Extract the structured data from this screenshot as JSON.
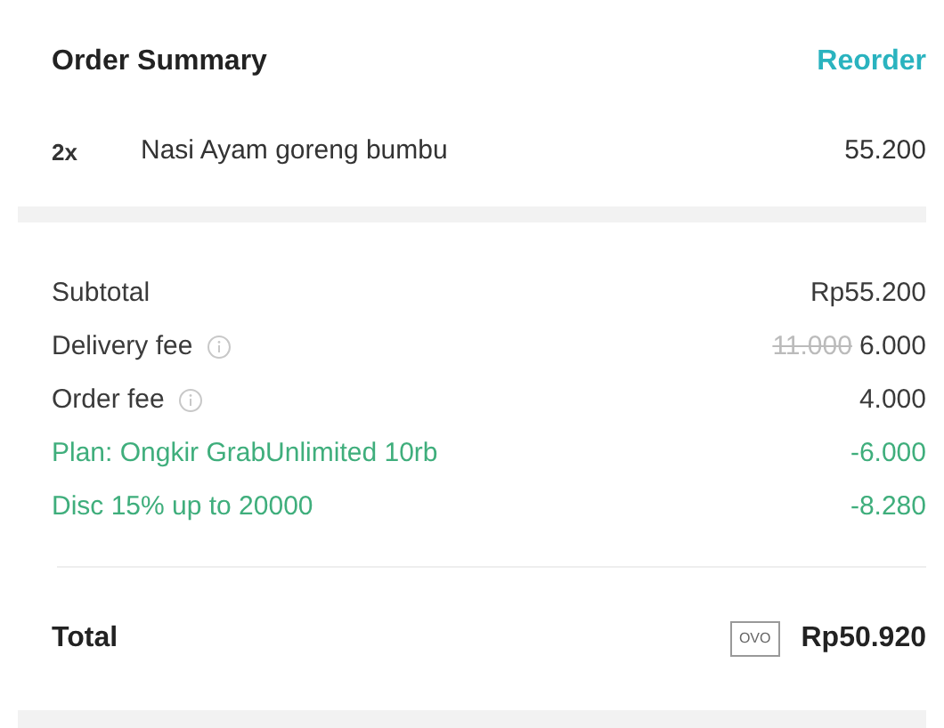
{
  "header": {
    "title": "Order Summary",
    "action": "Reorder"
  },
  "items": [
    {
      "quantity": "2x",
      "name": "Nasi Ayam goreng bumbu",
      "price": "55.200"
    }
  ],
  "lines": [
    {
      "kind": "charge",
      "label": "Subtotal",
      "info": false,
      "value": "Rp55.200"
    },
    {
      "kind": "charge",
      "label": "Delivery fee",
      "info": true,
      "original": "11.000",
      "value": "6.000"
    },
    {
      "kind": "charge",
      "label": "Order fee",
      "info": true,
      "value": "4.000"
    },
    {
      "kind": "discount",
      "label": "Plan: Ongkir GrabUnlimited 10rb",
      "info": false,
      "value": "-6.000"
    },
    {
      "kind": "discount",
      "label": "Disc 15% up to 20000",
      "info": false,
      "value": "-8.280"
    }
  ],
  "total": {
    "label": "Total",
    "payment": "OVO",
    "amount": "Rp50.920"
  }
}
